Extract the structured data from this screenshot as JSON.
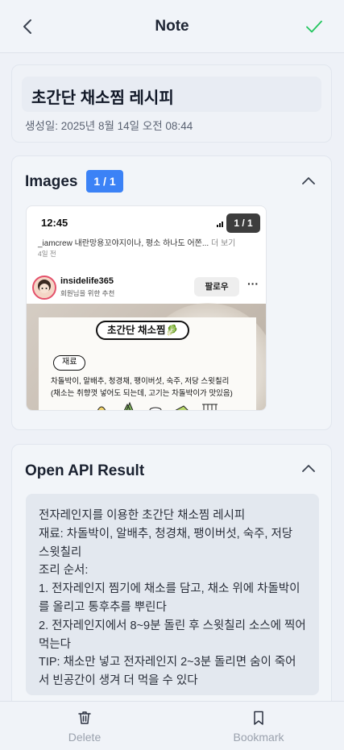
{
  "header": {
    "title": "Note",
    "back_icon": "chevron-left-icon",
    "confirm_icon": "check-icon",
    "confirm_color": "#22c55e"
  },
  "note": {
    "title": "초간단 채소찜 레시피",
    "created": "생성일: 2025년 8월 14일 오전 08:44"
  },
  "images_section": {
    "title": "Images",
    "badge": "1 / 1",
    "badge_color": "#3b82f6",
    "collapse_icon": "chevron-up-icon",
    "thumbnail": {
      "status_time": "12:45",
      "counter": "1 / 1",
      "caption_line": "_iamcrew 내란망용꼬야지이나, 평소 하나도 어쫀...",
      "caption_more": "더 보기",
      "caption_time": "4일 전",
      "username": "insidelife365",
      "user_sub": "회원님을 위한 추천",
      "follow_label": "팔로우",
      "more_icon": "ellipsis-icon",
      "recipe_title": "초간단 채소찜🥬",
      "ingredients_label": "재료",
      "ingredients_line1": "차돌박이, 알배추, 청경채, 팽이버섯, 숙주, 저당 스윗칠리",
      "ingredients_line2": "(채소는 취향껏 넣어도 되는데, 고기는 차돌박이가 맛있음)"
    }
  },
  "api_section": {
    "title": "Open API Result",
    "collapse_icon": "chevron-up-icon",
    "lines": [
      "전자레인지를 이용한 초간단 채소찜 레시피",
      "재료: 차돌박이, 알배추, 청경채, 팽이버섯, 숙주, 저당 스윗칠리",
      "조리 순서:",
      "1. 전자레인지 찜기에 채소를 담고, 채소 위에 차돌박이를 올리고 통후추를 뿌린다",
      "2. 전자레인지에서 8~9분 돌린 후 스윗칠리 소스에 찍어 먹는다",
      "TIP: 채소만 넣고 전자레인지 2~3분 돌리면 숨이 죽어서 빈공간이 생겨 더 먹을 수 있다"
    ]
  },
  "bottom_bar": {
    "delete_label": "Delete",
    "delete_icon": "trash-icon",
    "bookmark_label": "Bookmark",
    "bookmark_icon": "bookmark-icon"
  }
}
